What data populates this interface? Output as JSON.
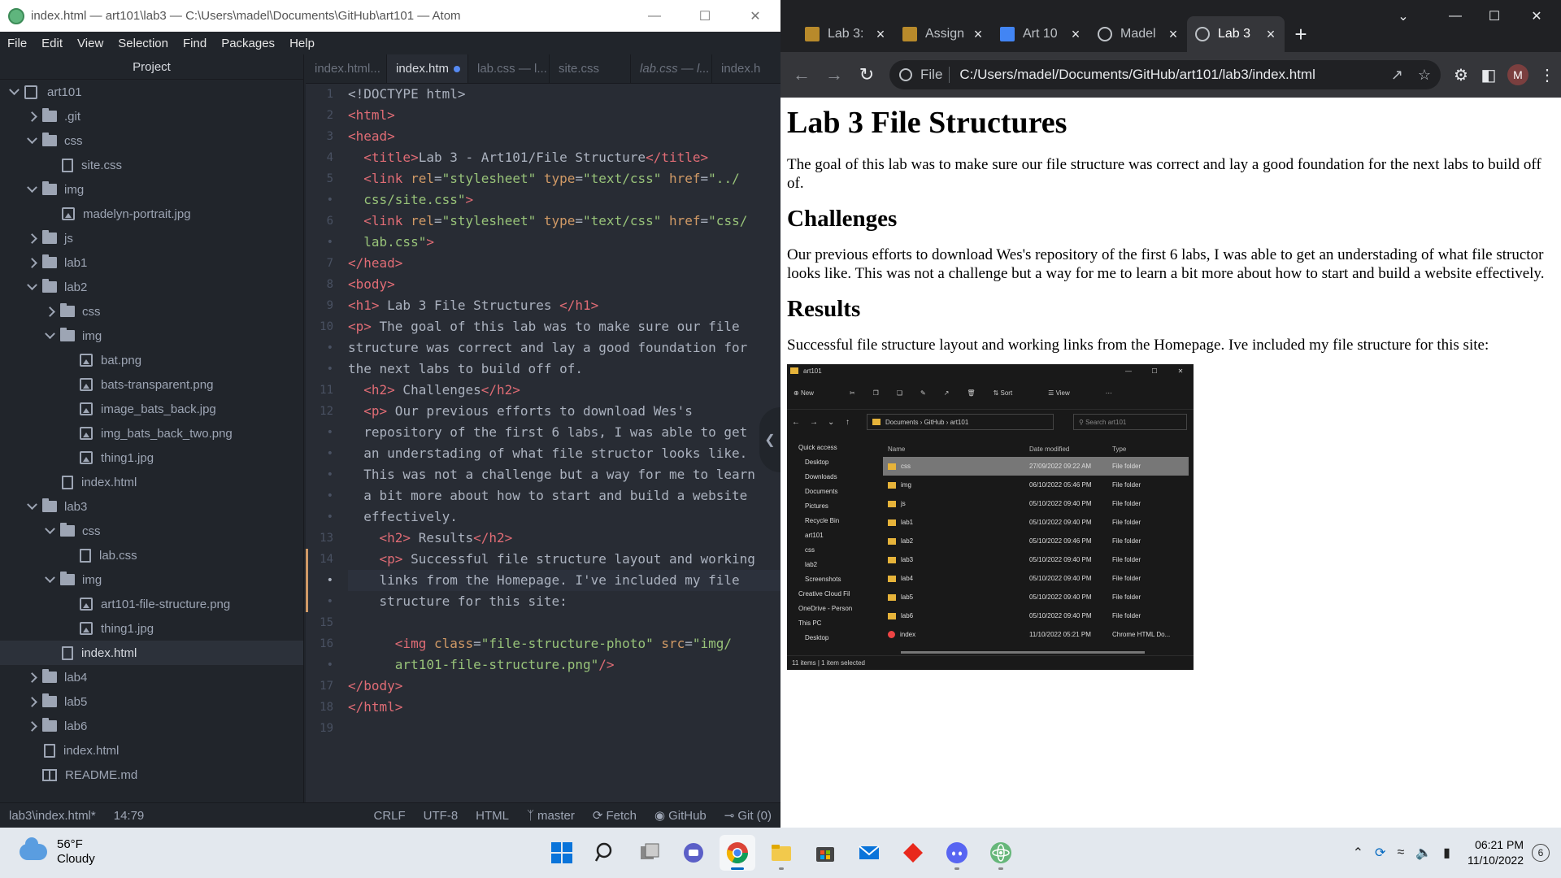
{
  "atom": {
    "title": "index.html — art101\\lab3 — C:\\Users\\madel\\Documents\\GitHub\\art101 — Atom",
    "menu": [
      "File",
      "Edit",
      "View",
      "Selection",
      "Find",
      "Packages",
      "Help"
    ],
    "project_label": "Project",
    "tree": [
      {
        "name": "art101",
        "type": "repo",
        "state": "open",
        "depth": 0
      },
      {
        "name": ".git",
        "type": "folder",
        "state": "closed",
        "depth": 1
      },
      {
        "name": "css",
        "type": "folder",
        "state": "open",
        "depth": 1
      },
      {
        "name": "site.css",
        "type": "file",
        "depth": 2
      },
      {
        "name": "img",
        "type": "folder",
        "state": "open",
        "depth": 1
      },
      {
        "name": "madelyn-portrait.jpg",
        "type": "image",
        "depth": 2
      },
      {
        "name": "js",
        "type": "folder",
        "state": "closed",
        "depth": 1
      },
      {
        "name": "lab1",
        "type": "folder",
        "state": "closed",
        "depth": 1
      },
      {
        "name": "lab2",
        "type": "folder",
        "state": "open",
        "depth": 1
      },
      {
        "name": "css",
        "type": "folder",
        "state": "closed",
        "depth": 2
      },
      {
        "name": "img",
        "type": "folder",
        "state": "open",
        "depth": 2
      },
      {
        "name": "bat.png",
        "type": "image",
        "depth": 3
      },
      {
        "name": "bats-transparent.png",
        "type": "image",
        "depth": 3
      },
      {
        "name": "image_bats_back.jpg",
        "type": "image",
        "depth": 3
      },
      {
        "name": "img_bats_back_two.png",
        "type": "image",
        "depth": 3
      },
      {
        "name": "thing1.jpg",
        "type": "image",
        "depth": 3
      },
      {
        "name": "index.html",
        "type": "file",
        "depth": 2
      },
      {
        "name": "lab3",
        "type": "folder",
        "state": "open",
        "depth": 1
      },
      {
        "name": "css",
        "type": "folder",
        "state": "open",
        "depth": 2
      },
      {
        "name": "lab.css",
        "type": "file",
        "depth": 3
      },
      {
        "name": "img",
        "type": "folder",
        "state": "open",
        "depth": 2
      },
      {
        "name": "art101-file-structure.png",
        "type": "image",
        "depth": 3
      },
      {
        "name": "thing1.jpg",
        "type": "image",
        "depth": 3
      },
      {
        "name": "index.html",
        "type": "file",
        "depth": 2,
        "selected": true
      },
      {
        "name": "lab4",
        "type": "folder",
        "state": "closed",
        "depth": 1
      },
      {
        "name": "lab5",
        "type": "folder",
        "state": "closed",
        "depth": 1
      },
      {
        "name": "lab6",
        "type": "folder",
        "state": "closed",
        "depth": 1
      },
      {
        "name": "index.html",
        "type": "file",
        "depth": 1
      },
      {
        "name": "README.md",
        "type": "book",
        "depth": 1
      }
    ],
    "tabs": [
      {
        "label": "index.html...",
        "active": false,
        "italic": false
      },
      {
        "label": "index.htm",
        "active": true,
        "italic": false,
        "modified": true
      },
      {
        "label": "lab.css — l...",
        "active": false,
        "italic": false
      },
      {
        "label": "site.css",
        "active": false,
        "italic": false
      },
      {
        "label": "lab.css — l...",
        "active": false,
        "italic": true
      },
      {
        "label": "index.h",
        "active": false,
        "italic": false
      }
    ],
    "code_lines": [
      {
        "n": "1",
        "html": "&lt;!DOCTYPE html&gt;"
      },
      {
        "n": "2",
        "html": "<span class='tg'>&lt;html&gt;</span>"
      },
      {
        "n": "3",
        "html": "<span class='tg'>&lt;head&gt;</span>"
      },
      {
        "n": "4",
        "html": "  <span class='tg'>&lt;title&gt;</span>Lab 3 - Art101/File Structure<span class='tg'>&lt;/title&gt;</span>"
      },
      {
        "n": "5",
        "html": "  <span class='tg'>&lt;link</span> <span class='at'>rel</span>=<span class='st'>\"stylesheet\"</span> <span class='at'>type</span>=<span class='st'>\"text/css\"</span> <span class='at'>href</span>=<span class='st'>\"../</span>"
      },
      {
        "n": "•",
        "html": "  <span class='st'>css/site.css\"</span><span class='tg'>&gt;</span>"
      },
      {
        "n": "6",
        "html": "  <span class='tg'>&lt;link</span> <span class='at'>rel</span>=<span class='st'>\"stylesheet\"</span> <span class='at'>type</span>=<span class='st'>\"text/css\"</span> <span class='at'>href</span>=<span class='st'>\"css/</span>"
      },
      {
        "n": "•",
        "html": "  <span class='st'>lab.css\"</span><span class='tg'>&gt;</span>"
      },
      {
        "n": "7",
        "html": "<span class='tg'>&lt;/head&gt;</span>"
      },
      {
        "n": "8",
        "html": "<span class='tg'>&lt;body&gt;</span>"
      },
      {
        "n": "9",
        "html": "<span class='tg'>&lt;h1&gt;</span> Lab 3 File Structures <span class='tg'>&lt;/h1&gt;</span>"
      },
      {
        "n": "10",
        "html": "<span class='tg'>&lt;p&gt;</span> The goal of this lab was to make sure our file"
      },
      {
        "n": "•",
        "html": "structure was correct and lay a good foundation for"
      },
      {
        "n": "•",
        "html": "the next labs to build off of."
      },
      {
        "n": "11",
        "html": "  <span class='tg'>&lt;h2&gt;</span> Challenges<span class='tg'>&lt;/h2&gt;</span>"
      },
      {
        "n": "12",
        "html": "  <span class='tg'>&lt;p&gt;</span> Our previous efforts to download Wes's"
      },
      {
        "n": "•",
        "html": "  repository of the first 6 labs, I was able to get"
      },
      {
        "n": "•",
        "html": "  an understading of what file structor looks like."
      },
      {
        "n": "•",
        "html": "  This was not a challenge but a way for me to learn"
      },
      {
        "n": "•",
        "html": "  a bit more about how to start and build a website"
      },
      {
        "n": "•",
        "html": "  effectively."
      },
      {
        "n": "13",
        "html": "    <span class='tg'>&lt;h2&gt;</span> Results<span class='tg'>&lt;/h2&gt;</span>"
      },
      {
        "n": "14",
        "html": "    <span class='tg'>&lt;p&gt;</span> Successful file structure layout and working"
      },
      {
        "n": "•",
        "html": "    links from the Homepage. I've included my file",
        "cur": true
      },
      {
        "n": "•",
        "html": "    structure for this site:"
      },
      {
        "n": "15",
        "html": ""
      },
      {
        "n": "16",
        "html": "      <span class='tg'>&lt;img</span> <span class='at'>class</span>=<span class='st'>\"file-structure-photo\"</span> <span class='at'>src</span>=<span class='st'>\"img/</span>"
      },
      {
        "n": "•",
        "html": "      <span class='st'>art101-file-structure.png\"</span><span class='tg'>/&gt;</span>"
      },
      {
        "n": "17",
        "html": "<span class='tg'>&lt;/body&gt;</span>"
      },
      {
        "n": "18",
        "html": "<span class='tg'>&lt;/html&gt;</span>"
      },
      {
        "n": "19",
        "html": ""
      }
    ],
    "status": {
      "file": "lab3\\index.html*",
      "cursor": "14:79",
      "line_ending": "CRLF",
      "encoding": "UTF-8",
      "grammar": "HTML",
      "branch": "master",
      "fetch": "Fetch",
      "github": "GitHub",
      "git": "Git (0)"
    }
  },
  "chrome": {
    "tabs": [
      {
        "label": "Lab 3:",
        "favicon": "y",
        "active": false
      },
      {
        "label": "Assign",
        "favicon": "y",
        "active": false
      },
      {
        "label": "Art 10",
        "favicon": "doc",
        "active": false
      },
      {
        "label": "Madel",
        "favicon": "globe",
        "active": false
      },
      {
        "label": "Lab 3",
        "favicon": "globe",
        "active": true
      }
    ],
    "omnibox": {
      "scheme_label": "File",
      "url": "C:/Users/madel/Documents/GitHub/art101/lab3/index.html"
    },
    "avatar_letter": "M",
    "page": {
      "h1": "Lab 3 File Structures",
      "p1": "The goal of this lab was to make sure our file structure was correct and lay a good foundation for the next labs to build off of.",
      "h2a": "Challenges",
      "p2": "Our previous efforts to download Wes's repository of the first 6 labs, I was able to get an understading of what file structor looks like. This was not a challenge but a way for me to learn a bit more about how to start and build a website effectively.",
      "h2b": "Results",
      "p3": "Successful file structure layout and working links from the Homepage. Ive included my file structure for this site:"
    },
    "explorer": {
      "title": "art101",
      "cmd": [
        "New",
        "Sort",
        "View"
      ],
      "path": [
        "Documents",
        "GitHub",
        "art101"
      ],
      "search_placeholder": "Search art101",
      "sidebar": [
        "Quick access",
        "Desktop",
        "Downloads",
        "Documents",
        "Pictures",
        "Recycle Bin",
        "art101",
        "css",
        "lab2",
        "Screenshots",
        "Creative Cloud Fil",
        "OneDrive - Person",
        "This PC",
        "Desktop"
      ],
      "headers": [
        "Name",
        "Date modified",
        "Type"
      ],
      "rows": [
        {
          "name": "css",
          "date": "27/09/2022 09:22 AM",
          "type": "File folder",
          "sel": true
        },
        {
          "name": "img",
          "date": "06/10/2022 05:46 PM",
          "type": "File folder"
        },
        {
          "name": "js",
          "date": "05/10/2022 09:40 PM",
          "type": "File folder"
        },
        {
          "name": "lab1",
          "date": "05/10/2022 09:40 PM",
          "type": "File folder"
        },
        {
          "name": "lab2",
          "date": "05/10/2022 09:46 PM",
          "type": "File folder"
        },
        {
          "name": "lab3",
          "date": "05/10/2022 09:40 PM",
          "type": "File folder"
        },
        {
          "name": "lab4",
          "date": "05/10/2022 09:40 PM",
          "type": "File folder"
        },
        {
          "name": "lab5",
          "date": "05/10/2022 09:40 PM",
          "type": "File folder"
        },
        {
          "name": "lab6",
          "date": "05/10/2022 09:40 PM",
          "type": "File folder"
        },
        {
          "name": "index",
          "date": "11/10/2022 05:21 PM",
          "type": "Chrome HTML Do...",
          "chrome": true
        }
      ],
      "status": "11 items  |  1 item selected"
    }
  },
  "taskbar": {
    "temp": "56°F",
    "condition": "Cloudy",
    "time": "06:21 PM",
    "date": "11/10/2022",
    "notifications": "6"
  }
}
